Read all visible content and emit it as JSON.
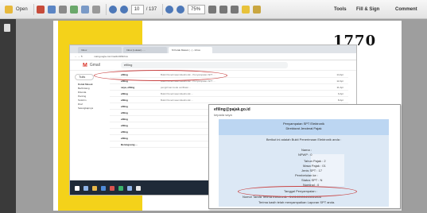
{
  "toolbar": {
    "open_label": "Open",
    "page_current": "10",
    "page_total": "/ 137",
    "zoom": "75%",
    "tools_label": "Tools",
    "fill_sign_label": "Fill & Sign",
    "comment_label": "Comment"
  },
  "document": {
    "page_number_print": "1770"
  },
  "browser": {
    "tabs": [
      "Inbox",
      "Inbox (Lokasi) - ...",
      "M Kotak Masuk (...) - Inbox"
    ],
    "url": "mail.google.com/mail/u/0/#inbox"
  },
  "gmail": {
    "app_name": "Gmail",
    "search_value": "efiling",
    "compose_label": "Tulis",
    "sidebar": [
      "Kotak Masuk",
      "Berbintang",
      "Ditunda",
      "Penting",
      "Terkirim",
      "Draf",
      "Selengkapnya"
    ],
    "rows": [
      {
        "sender": "efiling",
        "subject": "Bukti Penerimaan Elektronik - Penyampaian SPT ...",
        "date": "14 Apr"
      },
      {
        "sender": "efiling",
        "subject": "Bukti Penerimaan Elektronik - Penyampaian SPT ...",
        "date": "12 Apr"
      },
      {
        "sender": "saya, efiling",
        "subject": "pengiriman kode verifikasi ...",
        "date": "11 Apr"
      },
      {
        "sender": "efiling",
        "subject": "Bukti Penerimaan Elektronik ...",
        "date": "9 Apr"
      },
      {
        "sender": "efiling",
        "subject": "Bukti Penerimaan Elektronik ...",
        "date": "8 Apr"
      },
      {
        "sender": "efiling",
        "subject": "",
        "date": ""
      },
      {
        "sender": "efiling",
        "subject": "",
        "date": ""
      },
      {
        "sender": "efiling",
        "subject": "",
        "date": ""
      },
      {
        "sender": "efiling",
        "subject": "",
        "date": ""
      },
      {
        "sender": "efiling",
        "subject": "",
        "date": ""
      },
      {
        "sender": "efiling",
        "subject": "",
        "date": ""
      },
      {
        "sender": "Berangsung ...",
        "subject": "",
        "date": ""
      }
    ]
  },
  "email": {
    "from": "efiling@pajak.go.id",
    "to": "kepada saya",
    "header_line1": "Penyampaian SPT Elektronik",
    "header_line2": "Direktorat Jenderal Pajak",
    "intro": "Berikut ini adalah Bukti Penerimaan Elektronik anda :",
    "fields": [
      "Nama :",
      "NPWP : 0",
      "Tahun Pajak : 2",
      "Masa Pajak : 01",
      "Jenis SPT : 17",
      "Pembetulan ke :",
      "Status SPT : N",
      "Nominal : 0"
    ],
    "date_label": "Tanggal Penyampaian :",
    "receipt_line": "Nomor Tanda Terima Elektronik : 510100000415051806",
    "thanks": "Terima kasih telah menyampaikan Laporan SPT anda."
  }
}
